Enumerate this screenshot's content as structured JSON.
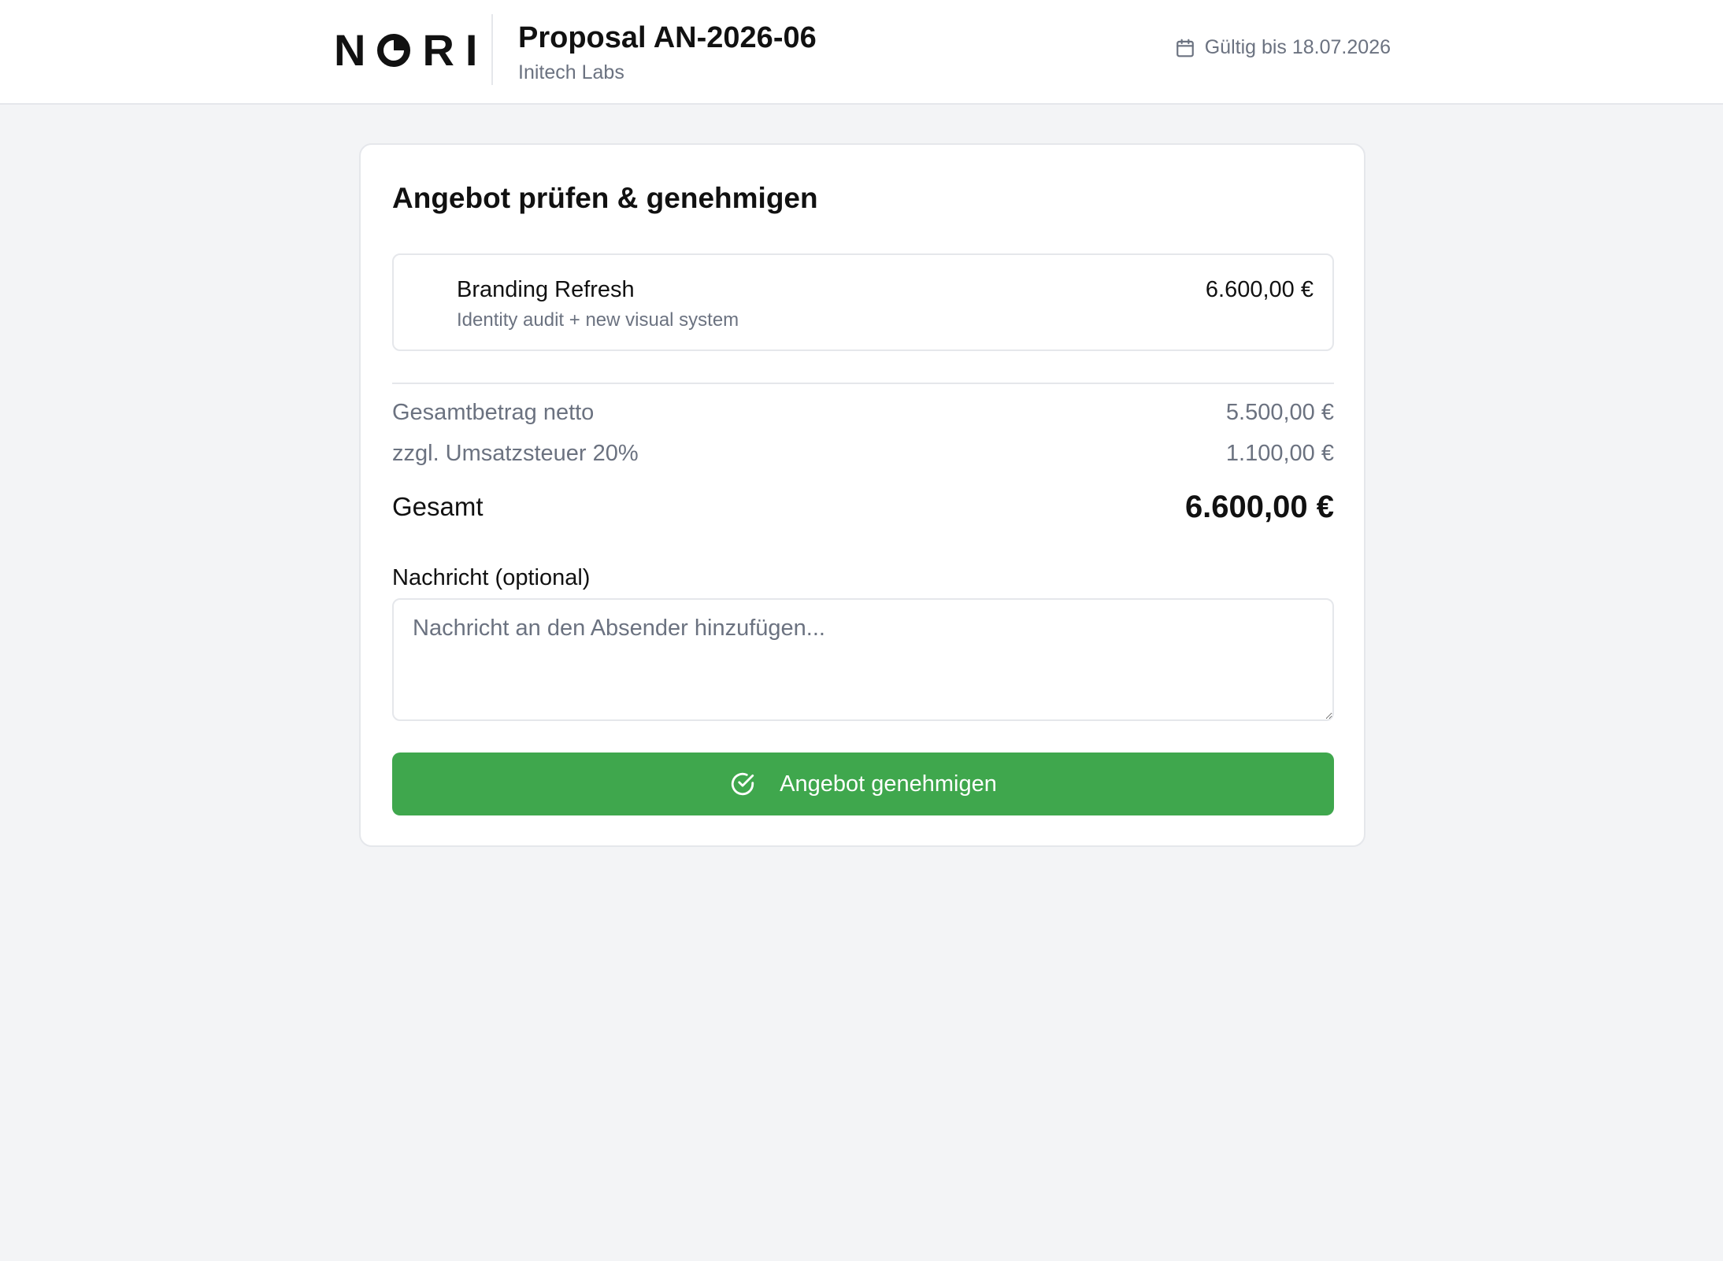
{
  "header": {
    "logo_text_left": "N",
    "logo_text_right": "RI",
    "title": "Proposal AN-2026-06",
    "subtitle": "Initech Labs",
    "validity_text": "Gültig bis 18.07.2026",
    "validity_icon": "calendar-icon"
  },
  "card": {
    "title": "Angebot prüfen & genehmigen",
    "line_items": [
      {
        "name": "Branding Refresh",
        "description": "Identity audit + new visual system",
        "price": "6.600,00 €"
      }
    ],
    "totals": {
      "subtotal_label": "Gesamtbetrag netto",
      "subtotal_value": "5.500,00 €",
      "tax_label": "zzgl. Umsatzsteuer 20%",
      "tax_value": "1.100,00 €",
      "total_label": "Gesamt",
      "total_value": "6.600,00 €"
    },
    "message": {
      "label": "Nachricht (optional)",
      "placeholder": "Nachricht an den Absender hinzufügen...",
      "value": ""
    },
    "approve_button": {
      "label": "Angebot genehmigen",
      "icon": "check-circle-icon"
    }
  },
  "colors": {
    "page_background": "#f3f4f6",
    "accent_green": "#3fa74d",
    "muted_text": "#6b7280",
    "border": "#e5e7eb"
  }
}
